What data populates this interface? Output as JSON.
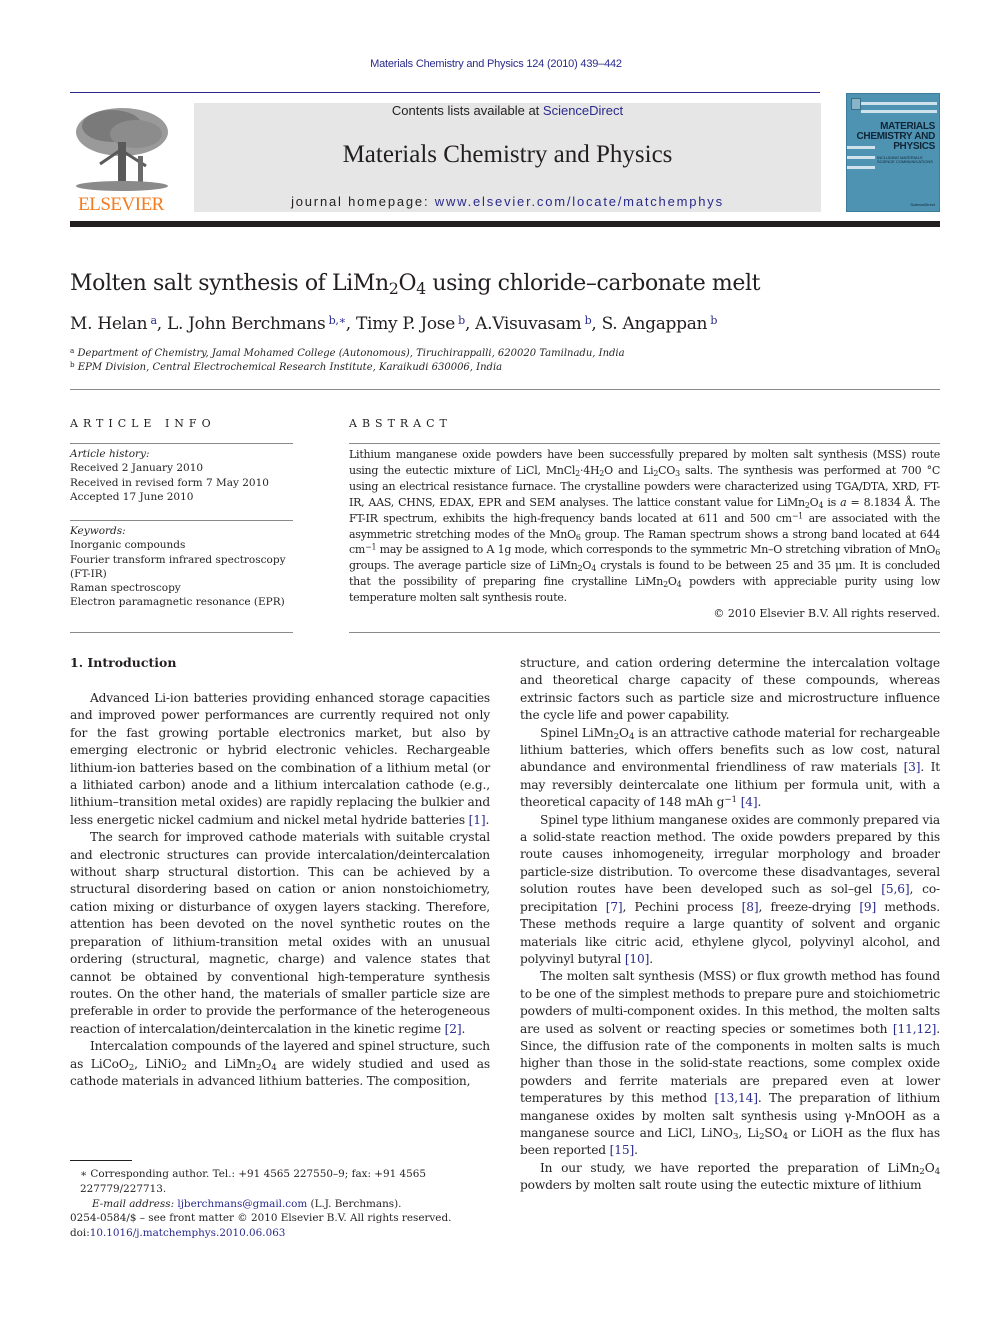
{
  "header": {
    "citation": "Materials Chemistry and Physics 124 (2010) 439–442",
    "contents_prefix": "Contents lists available at ",
    "contents_link": "ScienceDirect",
    "journal_name": "Materials Chemistry and Physics",
    "homepage_prefix": "journal homepage: ",
    "homepage_url": "www.elsevier.com/locate/matchemphys",
    "publisher_logo_text": "ELSEVIER",
    "cover": {
      "title_lines": [
        "MATERIALS",
        "CHEMISTRY AND",
        "PHYSICS"
      ],
      "subtitle": "INCLUDING MATERIALS SCIENCE COMMUNICATIONS",
      "publisher": "ScienceDirect"
    },
    "colors": {
      "link": "#2a2a8c",
      "elsevier_orange": "#f47b20",
      "banner_bg": "#e6e6e6",
      "cover_bg": "#4f93b3"
    }
  },
  "article": {
    "title": [
      {
        "t": "Molten salt synthesis of LiMn"
      },
      {
        "sub": "2"
      },
      {
        "t": "O"
      },
      {
        "sub": "4"
      },
      {
        "t": " using chloride–carbonate melt"
      }
    ],
    "authors": [
      {
        "name": "M. Helan",
        "aff": "a"
      },
      {
        "name": "L. John Berchmans",
        "aff": "b,∗"
      },
      {
        "name": "Timy P. Jose",
        "aff": "b"
      },
      {
        "name": "A.Visuvasam",
        "aff": "b"
      },
      {
        "name": "S. Angappan",
        "aff": "b"
      }
    ],
    "affiliations": [
      {
        "key": "a",
        "text": "Department of Chemistry, Jamal Mohamed College (Autonomous), Tiruchirappalli, 620020 Tamilnadu, India"
      },
      {
        "key": "b",
        "text": "EPM Division, Central Electrochemical Research Institute, Karaikudi 630006, India"
      }
    ]
  },
  "article_info": {
    "heading": "ARTICLE INFO",
    "history_label": "Article history:",
    "history": [
      "Received 2 January 2010",
      "Received in revised form 7 May 2010",
      "Accepted 17 June 2010"
    ],
    "keywords_label": "Keywords:",
    "keywords": [
      "Inorganic compounds",
      "Fourier transform infrared spectroscopy",
      "(FT-IR)",
      "Raman spectroscopy",
      "Electron paramagnetic resonance (EPR)"
    ]
  },
  "abstract": {
    "heading": "ABSTRACT",
    "body": [
      {
        "t": "Lithium manganese oxide powders have been successfully prepared by molten salt synthesis (MSS) route using the eutectic mixture of LiCl, MnCl"
      },
      {
        "sub": "2"
      },
      {
        "t": "·4H"
      },
      {
        "sub": "2"
      },
      {
        "t": "O and Li"
      },
      {
        "sub": "2"
      },
      {
        "t": "CO"
      },
      {
        "sub": "3"
      },
      {
        "t": " salts. The synthesis was performed at 700 °C using an electrical resistance furnace. The crystalline powders were characterized using TGA/DTA, XRD, FT-IR, AAS, CHNS, EDAX, EPR and SEM analyses. The lattice constant value for LiMn"
      },
      {
        "sub": "2"
      },
      {
        "t": "O"
      },
      {
        "sub": "4"
      },
      {
        "t": " is "
      },
      {
        "i": "a"
      },
      {
        "t": " = 8.1834 Å. The FT-IR spectrum, exhibits the high-frequency bands located at 611 and 500 cm"
      },
      {
        "sup": "−1"
      },
      {
        "t": " are associated with the asymmetric stretching modes of the MnO"
      },
      {
        "sub": "6"
      },
      {
        "t": " group. The Raman spectrum shows a strong band located at 644 cm"
      },
      {
        "sup": "−1"
      },
      {
        "t": " may be assigned to A 1g mode, which corresponds to the symmetric Mn–O stretching vibration of MnO"
      },
      {
        "sub": "6"
      },
      {
        "t": " groups. The average particle size of LiMn"
      },
      {
        "sub": "2"
      },
      {
        "t": "O"
      },
      {
        "sub": "4"
      },
      {
        "t": " crystals is found to be between 25 and 35 μm. It is concluded that the possibility of preparing fine crystalline LiMn"
      },
      {
        "sub": "2"
      },
      {
        "t": "O"
      },
      {
        "sub": "4"
      },
      {
        "t": " powders with appreciable purity using low temperature molten salt synthesis route."
      }
    ],
    "copyright": "© 2010 Elsevier B.V. All rights reserved."
  },
  "introduction": {
    "heading": "1.  Introduction",
    "left_paragraphs": [
      [
        {
          "t": "Advanced Li-ion batteries providing enhanced storage capacities and improved power performances are currently required not only for the fast growing portable electronics market, but also by emerging electronic or hybrid electronic vehicles. Rechargeable lithium-ion batteries based on the combination of a lithium metal (or a lithiated carbon) anode and a lithium intercalation cathode (e.g., lithium–transition metal oxides) are rapidly replacing the bulkier and less energetic nickel cadmium and nickel metal hydride batteries "
        },
        {
          "ref": "[1]"
        },
        {
          "t": "."
        }
      ],
      [
        {
          "t": "The search for improved cathode materials with suitable crystal and electronic structures can provide intercalation/deintercalation without sharp structural distortion. This can be achieved by a structural disordering based on cation or anion nonstoichiometry, cation mixing or disturbance of oxygen layers stacking. Therefore, attention has been devoted on the novel synthetic routes on the preparation of lithium-transition metal oxides with an unusual ordering (structural, magnetic, charge) and valence states that cannot be obtained by conventional high-temperature synthesis routes. On the other hand, the materials of smaller particle size are preferable in order to provide the performance of the heterogeneous reaction of intercalation/deintercalation in the kinetic regime "
        },
        {
          "ref": "[2]"
        },
        {
          "t": "."
        }
      ],
      [
        {
          "t": "Intercalation compounds of the layered and spinel structure, such as LiCoO"
        },
        {
          "sub": "2"
        },
        {
          "t": ", LiNiO"
        },
        {
          "sub": "2"
        },
        {
          "t": " and LiMn"
        },
        {
          "sub": "2"
        },
        {
          "t": "O"
        },
        {
          "sub": "4"
        },
        {
          "t": " are widely studied and used as cathode materials in advanced lithium batteries. The composition,"
        }
      ]
    ],
    "right_paragraphs": [
      [
        {
          "t": "structure, and cation ordering determine the intercalation voltage and theoretical charge capacity of these compounds, whereas extrinsic factors such as particle size and microstructure influence the cycle life and power capability."
        }
      ],
      [
        {
          "t": "Spinel LiMn"
        },
        {
          "sub": "2"
        },
        {
          "t": "O"
        },
        {
          "sub": "4"
        },
        {
          "t": " is an attractive cathode material for rechargeable lithium batteries, which offers benefits such as low cost, natural abundance and environmental friendliness of raw materials "
        },
        {
          "ref": "[3]"
        },
        {
          "t": ". It may reversibly deintercalate one lithium per formula unit, with a theoretical capacity of 148 mAh g"
        },
        {
          "sup": "−1"
        },
        {
          "t": " "
        },
        {
          "ref": "[4]"
        },
        {
          "t": "."
        }
      ],
      [
        {
          "t": "Spinel type lithium manganese oxides are commonly prepared via a solid-state reaction method. The oxide powders prepared by this route causes inhomogeneity, irregular morphology and broader particle-size distribution. To overcome these disadvantages, several solution routes have been developed such as sol–gel "
        },
        {
          "ref": "[5,6]"
        },
        {
          "t": ", co-precipitation "
        },
        {
          "ref": "[7]"
        },
        {
          "t": ", Pechini process "
        },
        {
          "ref": "[8]"
        },
        {
          "t": ", freeze-drying "
        },
        {
          "ref": "[9]"
        },
        {
          "t": " methods. These methods require a large quantity of solvent and organic materials like citric acid, ethylene glycol, polyvinyl alcohol, and polyvinyl butyral "
        },
        {
          "ref": "[10]"
        },
        {
          "t": "."
        }
      ],
      [
        {
          "t": "The molten salt synthesis (MSS) or flux growth method has found to be one of the simplest methods to prepare pure and stoichiometric powders of multi-component oxides. In this method, the molten salts are used as solvent or reacting species or sometimes both "
        },
        {
          "ref": "[11,12]"
        },
        {
          "t": ". Since, the diffusion rate of the components in molten salts is much higher than those in the solid-state reactions, some complex oxide powders and ferrite materials are prepared even at lower temperatures by this method "
        },
        {
          "ref": "[13,14]"
        },
        {
          "t": ". The preparation of lithium manganese oxides by molten salt synthesis using γ-MnOOH as a manganese source and LiCl, LiNO"
        },
        {
          "sub": "3"
        },
        {
          "t": ", Li"
        },
        {
          "sub": "2"
        },
        {
          "t": "SO"
        },
        {
          "sub": "4"
        },
        {
          "t": " or LiOH as the flux has been reported "
        },
        {
          "ref": "[15]"
        },
        {
          "t": "."
        }
      ],
      [
        {
          "t": "In our study, we have reported the preparation of LiMn"
        },
        {
          "sub": "2"
        },
        {
          "t": "O"
        },
        {
          "sub": "4"
        },
        {
          "t": " powders by molten salt route using the eutectic mixture of lithium"
        }
      ]
    ]
  },
  "footnote": {
    "corresponding": "∗ Corresponding author. Tel.: +91 4565 227550–9; fax: +91 4565 227779/227713.",
    "email_label": "E-mail address: ",
    "email": "ljberchmans@gmail.com",
    "email_suffix": " (L.J. Berchmans)."
  },
  "front_matter": {
    "issn_line": "0254-0584/$ – see front matter © 2010 Elsevier B.V. All rights reserved.",
    "doi_prefix": "doi:",
    "doi": "10.1016/j.matchemphys.2010.06.063"
  }
}
